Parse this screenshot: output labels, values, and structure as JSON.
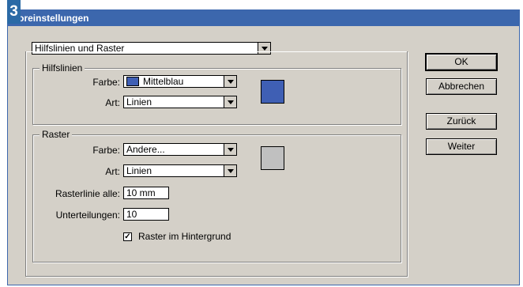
{
  "step_number": "3",
  "window": {
    "title": "Voreinstellungen"
  },
  "category_select": {
    "value": "Hilfslinien und Raster"
  },
  "hilfslinien": {
    "group_label": "Hilfslinien",
    "color_label": "Farbe:",
    "color_value": "Mittelblau",
    "color_hex": "#3f5fb4",
    "style_label": "Art:",
    "style_value": "Linien"
  },
  "raster": {
    "group_label": "Raster",
    "color_label": "Farbe:",
    "color_value": "Andere...",
    "color_hex": "#c0c0c0",
    "style_label": "Art:",
    "style_value": "Linien",
    "gridline_label": "Rasterlinie alle:",
    "gridline_value": "10 mm",
    "subdivisions_label": "Unterteilungen:",
    "subdivisions_value": "10",
    "background_checkbox_label": "Raster im Hintergrund",
    "background_checked": true
  },
  "buttons": {
    "ok": "OK",
    "cancel": "Abbrechen",
    "prev": "Zurück",
    "next": "Weiter"
  },
  "colors": {
    "titlebar": "#3c67ad",
    "dialog_bg": "#d4d0c8"
  }
}
